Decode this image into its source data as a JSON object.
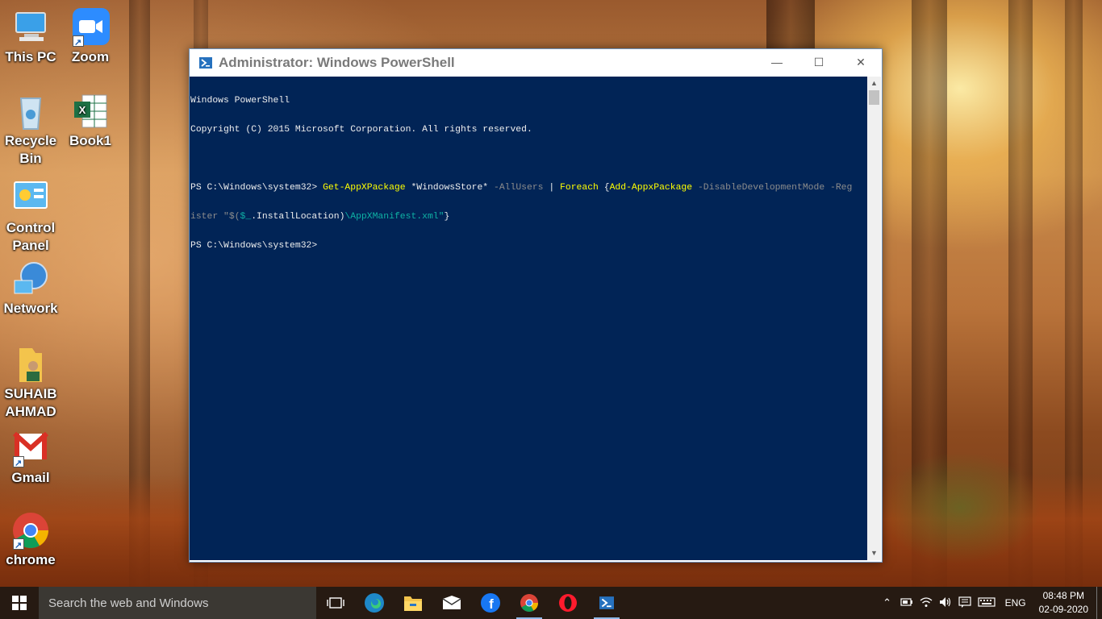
{
  "desktop_icons": [
    {
      "label": "This PC",
      "icon": "computer-icon"
    },
    {
      "label": "Zoom",
      "icon": "zoom-icon"
    },
    {
      "label": "Recycle Bin",
      "icon": "recycle-bin-icon"
    },
    {
      "label": "Book1",
      "icon": "excel-icon"
    },
    {
      "label": "Control Panel",
      "icon": "control-panel-icon"
    },
    {
      "label": "Network",
      "icon": "network-icon"
    },
    {
      "label": "SUHAIB AHMAD",
      "icon": "user-folder-icon"
    },
    {
      "label": "Gmail",
      "icon": "gmail-icon"
    },
    {
      "label": "chrome",
      "icon": "chrome-icon"
    }
  ],
  "window": {
    "title": "Administrator: Windows PowerShell",
    "controls": {
      "minimize": "—",
      "maximize": "☐",
      "close": "✕"
    },
    "console": {
      "line1": "Windows PowerShell",
      "line2": "Copyright (C) 2015 Microsoft Corporation. All rights reserved.",
      "prompt1": "PS C:\\Windows\\system32> ",
      "cmd_get": "Get-AppXPackage",
      "cmd_arg1": " *WindowsStore* ",
      "cmd_param1": "-AllUsers",
      "cmd_pipe": " | ",
      "cmd_foreach": "Foreach",
      "cmd_brace_open": " {",
      "cmd_add": "Add-AppxPackage",
      "cmd_space": " ",
      "cmd_param2": "-DisableDevelopmentMode -Reg",
      "cmd_param2b": "ister",
      "cmd_str_open": " \"$(",
      "cmd_var": "$_",
      "cmd_install": ".InstallLocation)",
      "cmd_path": "\\AppXManifest.xml\"",
      "cmd_brace_close": "}",
      "prompt2": "PS C:\\Windows\\system32>"
    }
  },
  "taskbar": {
    "search_placeholder": "Search the web and Windows",
    "apps": [
      "task-view-icon",
      "edge-icon",
      "file-explorer-icon",
      "mail-icon",
      "facebook-icon",
      "chrome-icon",
      "opera-icon",
      "powershell-icon"
    ],
    "tray": {
      "language": "ENG",
      "time": "08:48 PM",
      "date": "02-09-2020"
    }
  },
  "colors": {
    "console_bg": "#012456",
    "console_yellow": "#ffff00",
    "console_gray": "#8c8c8c",
    "console_teal": "#0fb2a5"
  }
}
